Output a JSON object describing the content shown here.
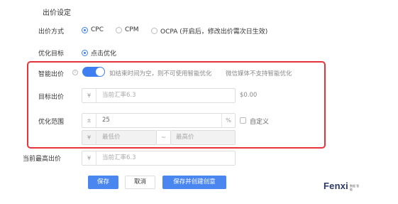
{
  "section": {
    "title": "出价设定"
  },
  "bid_method": {
    "label": "出价方式",
    "options": [
      {
        "label": "CPC",
        "checked": true
      },
      {
        "label": "CPM",
        "checked": false
      },
      {
        "label": "OCPA (开启后，修改出价需次日生效)",
        "checked": false
      }
    ]
  },
  "optimize_target": {
    "label": "优化目标",
    "option": {
      "label": "点击优化",
      "checked": true
    }
  },
  "smart_bid": {
    "label": "智能出价",
    "enabled": true,
    "note1": "如结束时间为空，则不可使用智能优化",
    "note2": "微信媒体不支持智能优化"
  },
  "target_bid": {
    "label": "目标出价",
    "prefix": "¥",
    "placeholder": "当前汇率6.3",
    "value_hint": "$0.00"
  },
  "optimize_range": {
    "label": "优化范围",
    "prefix": "±",
    "value": "25",
    "suffix": "%",
    "custom_label": "自定义",
    "min_prefix": "¥",
    "min_placeholder": "最低价",
    "separator": "~",
    "max_placeholder": "最高价"
  },
  "current_max_bid": {
    "label": "当前最高出价",
    "prefix": "¥",
    "placeholder": "当前汇率6.3"
  },
  "buttons": {
    "save": "保存",
    "cancel": "取消",
    "save_create": "保存并创建创意"
  },
  "logo": {
    "text": "Fenxi",
    "sub": "数据 智能"
  },
  "colors": {
    "accent": "#3d7ff0",
    "highlight_border": "#e5343a",
    "primary_button": "#4a86f0"
  }
}
